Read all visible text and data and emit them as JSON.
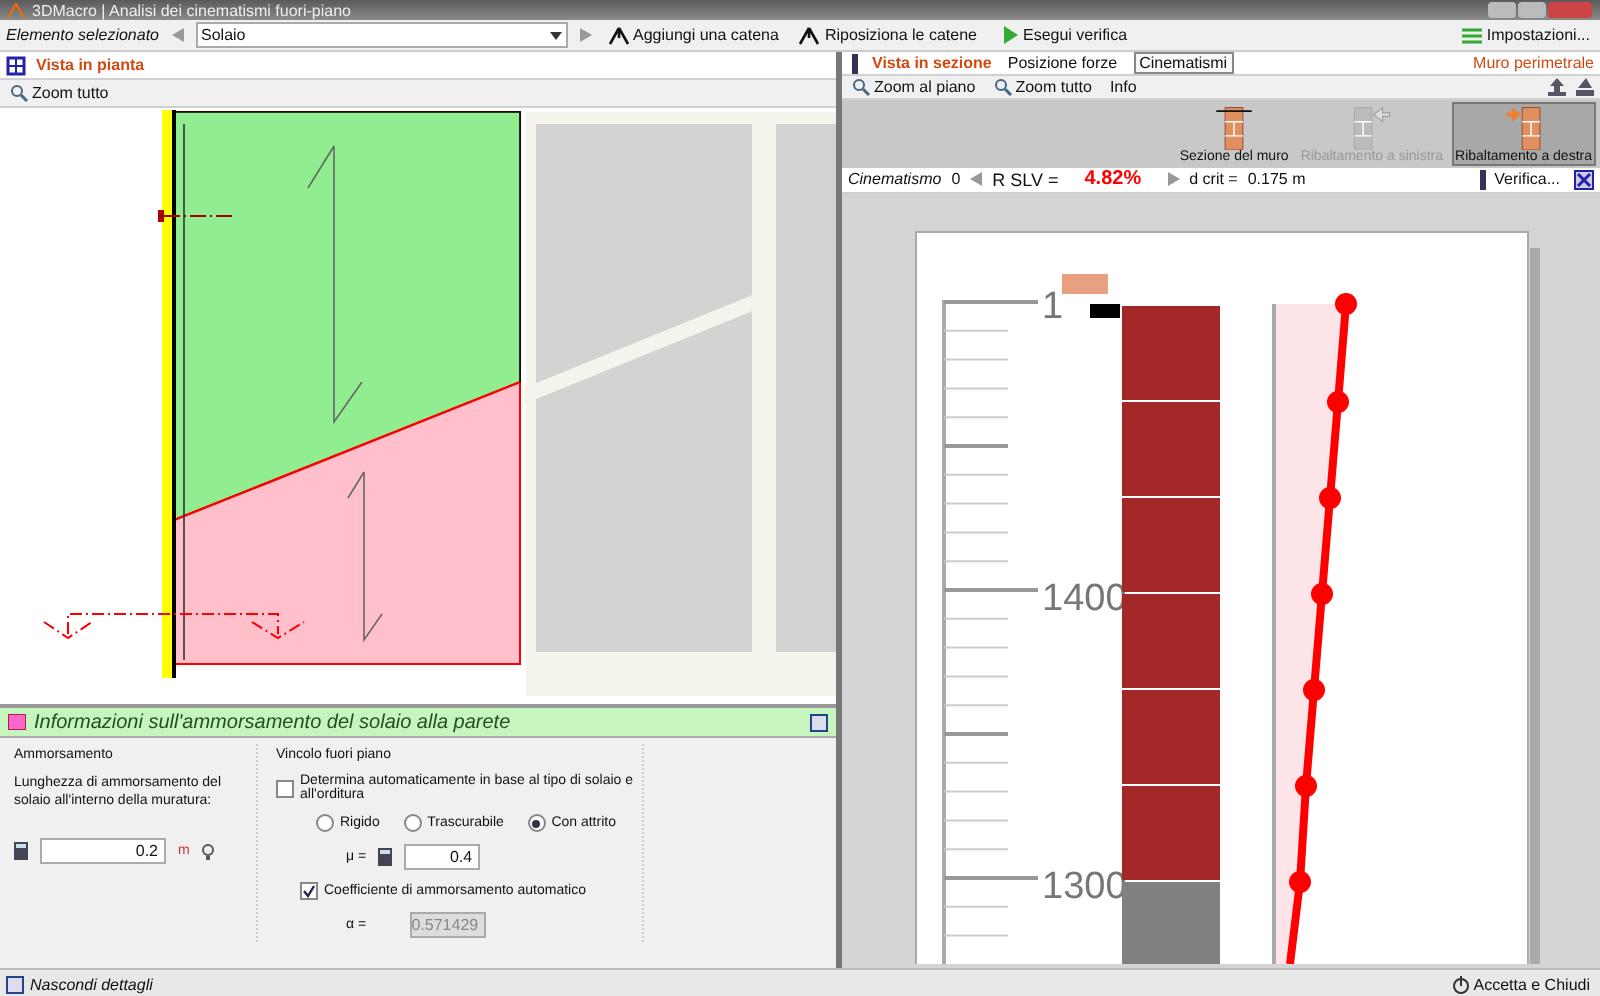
{
  "window": {
    "title": "3DMacro | Analisi dei cinematismi fuori-piano",
    "settings_button": "Impostazioni..."
  },
  "toolbar": {
    "element_label": "Elemento selezionato",
    "element_value": "Solaio",
    "buttons": [
      {
        "label": "Aggiungi una catena",
        "kind": "chain"
      },
      {
        "label": "Riposiziona le catene",
        "kind": "chain"
      },
      {
        "label": "Esegui verifica",
        "kind": "run"
      }
    ]
  },
  "plan_view": {
    "title": "Vista in pianta",
    "zoom_button": "Zoom tutto"
  },
  "section_view": {
    "title": "Vista in sezione",
    "tabs": [
      {
        "label": "Posizione forze",
        "selected": false
      },
      {
        "label": "Cinematismi",
        "selected": true
      }
    ],
    "wall_name": "Muro perimetrale",
    "tools": [
      "Zoom al piano",
      "Zoom tutto",
      "Info"
    ],
    "modes": [
      {
        "label": "Sezione del muro",
        "selected": false,
        "disabled": false,
        "kind": "section"
      },
      {
        "label": "Ribaltamento a sinistra",
        "selected": false,
        "disabled": true,
        "kind": "left"
      },
      {
        "label": "Ribaltamento a destra",
        "selected": true,
        "disabled": false,
        "kind": "right"
      }
    ],
    "mechanism_label": "Cinematismo",
    "mechanism_index": "0",
    "rslv_label": "R SLV =",
    "rslv_value": "4.82%",
    "dcrit_label": "d crit =",
    "dcrit_value": "0.175 m",
    "verify_button": "Verifica...",
    "ruler_labels": [
      "1",
      "1400",
      "1300"
    ]
  },
  "anchorage_panel": {
    "title": "Informazioni sull'ammorsamento del solaio alla parete",
    "anchorage_group": {
      "title": "Ammorsamento",
      "description": "Lunghezza di ammorsamento del solaio all'interno della muratura:",
      "value": "0.2",
      "unit": "m"
    },
    "constraint_group": {
      "title": "Vincolo fuori piano",
      "auto_checkbox": {
        "label": "Determina automaticamente in base al tipo di solaio e all'orditura",
        "checked": false
      },
      "options": [
        {
          "label": "Rigido",
          "selected": false
        },
        {
          "label": "Trascurabile",
          "selected": false
        },
        {
          "label": "Con attrito",
          "selected": true
        }
      ],
      "mu_label": "μ =",
      "mu_value": "0.4",
      "coef_checkbox": {
        "label": "Coefficiente di ammorsamento automatico",
        "checked": true
      },
      "alpha_label": "α =",
      "alpha_value": "0.571429",
      "alpha_disabled": true
    }
  },
  "status_bar": {
    "hide_details": "Nascondi dettagli",
    "accept_button": "Accetta e Chiudi"
  }
}
